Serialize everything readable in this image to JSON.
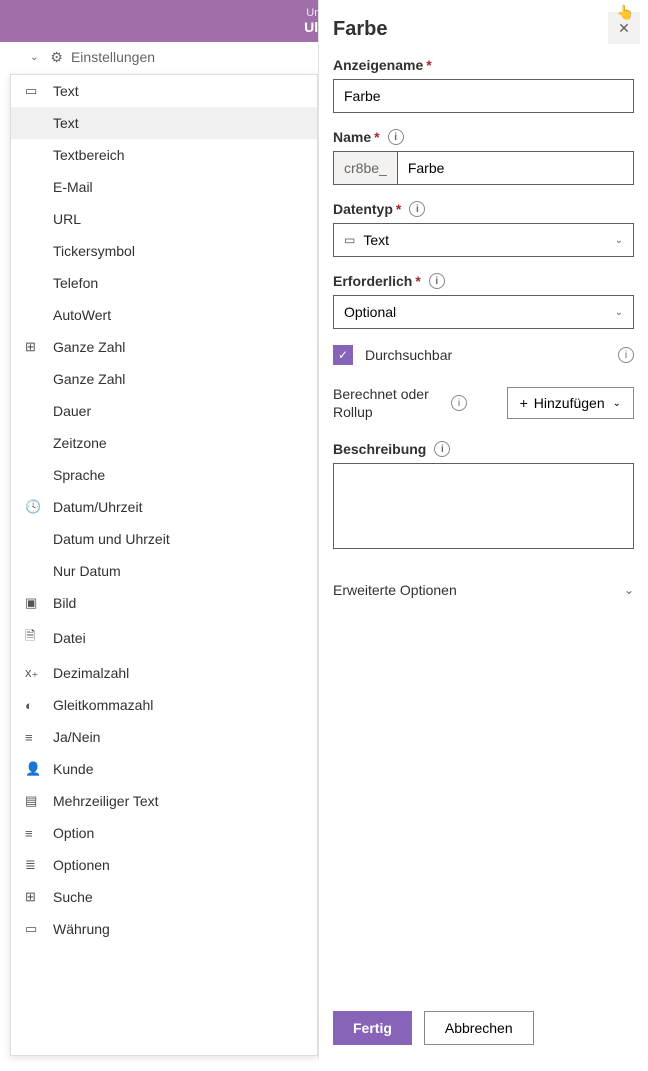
{
  "header": {
    "sub": "Umgeb",
    "main": "Ulrich"
  },
  "settings_label": "Einstellungen",
  "dropdown": {
    "groups": [
      {
        "cat": "Text",
        "icon": "▭",
        "items": [
          "Text",
          "Textbereich",
          "E-Mail",
          "URL",
          "Tickersymbol",
          "Telefon",
          "AutoWert"
        ],
        "selected": 0
      },
      {
        "cat": "Ganze Zahl",
        "icon": "⊞",
        "items": [
          "Ganze Zahl",
          "Dauer",
          "Zeitzone",
          "Sprache"
        ]
      },
      {
        "cat": "Datum/Uhrzeit",
        "icon": "🕓",
        "items": [
          "Datum und Uhrzeit",
          "Nur Datum"
        ]
      }
    ],
    "flat": [
      {
        "label": "Bild",
        "icon": "▣"
      },
      {
        "label": "Datei",
        "icon": "🗎"
      },
      {
        "label": "Dezimalzahl",
        "icon": "x₊"
      },
      {
        "label": "Gleitkommazahl",
        "icon": "◐"
      },
      {
        "label": "Ja/Nein",
        "icon": "≡"
      },
      {
        "label": "Kunde",
        "icon": "👤"
      },
      {
        "label": "Mehrzeiliger Text",
        "icon": "▤"
      },
      {
        "label": "Option",
        "icon": "≡"
      },
      {
        "label": "Optionen",
        "icon": "≣"
      },
      {
        "label": "Suche",
        "icon": "⊞"
      },
      {
        "label": "Währung",
        "icon": "▭"
      }
    ]
  },
  "panel": {
    "title": "Farbe",
    "display_name": {
      "label": "Anzeigename",
      "value": "Farbe"
    },
    "name": {
      "label": "Name",
      "prefix": "cr8be_",
      "value": "Farbe"
    },
    "datatype": {
      "label": "Datentyp",
      "value": "Text"
    },
    "required": {
      "label": "Erforderlich",
      "value": "Optional"
    },
    "searchable": {
      "label": "Durchsuchbar",
      "checked": true
    },
    "calc": {
      "label": "Berechnet oder Rollup",
      "button": "Hinzufügen"
    },
    "description": {
      "label": "Beschreibung"
    },
    "advanced": "Erweiterte Optionen",
    "footer": {
      "primary": "Fertig",
      "secondary": "Abbrechen"
    }
  }
}
